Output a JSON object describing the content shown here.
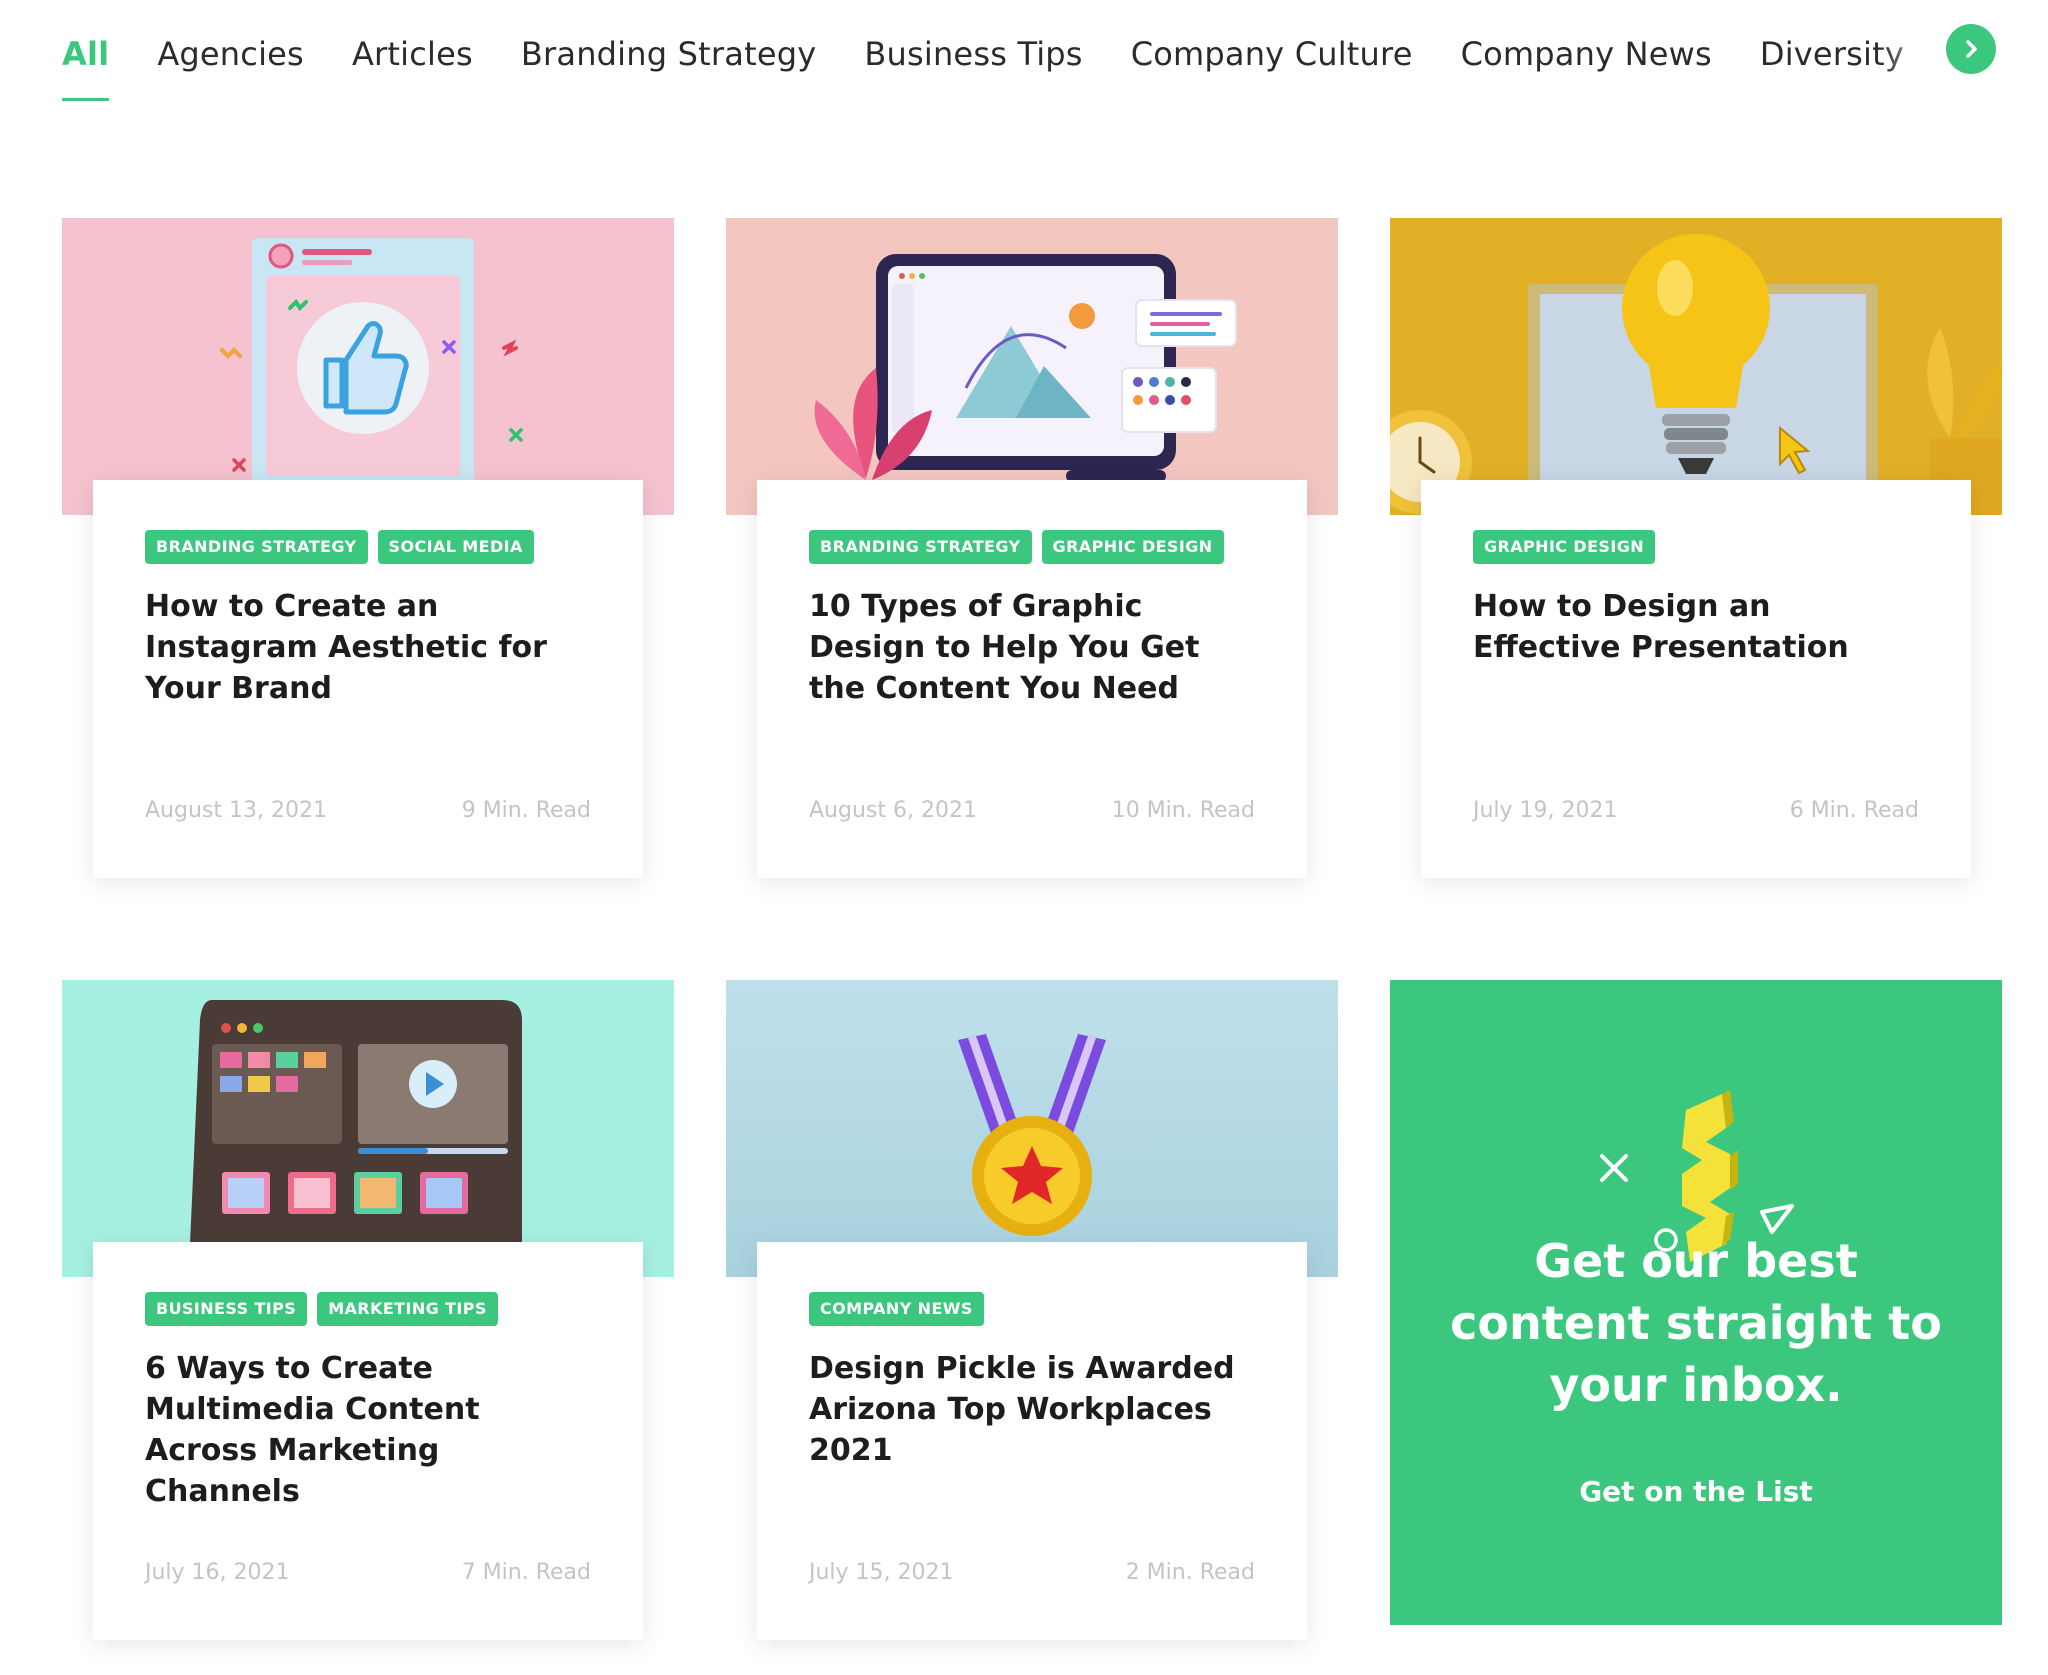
{
  "tabs": {
    "items": [
      "All",
      "Agencies",
      "Articles",
      "Branding Strategy",
      "Business Tips",
      "Company Culture",
      "Company News",
      "Diversity"
    ]
  },
  "colors": {
    "accent": "#3cc77f",
    "meta": "#c4c4c4",
    "title": "#1d1d1d"
  },
  "posts": [
    {
      "tags": [
        "Branding Strategy",
        "Social Media"
      ],
      "title": "How to Create an Instagram Aesthetic for Your Brand",
      "date": "August 13, 2021",
      "read_time": "9 Min. Read",
      "image": "thumbs-up-social-post-illustration"
    },
    {
      "tags": [
        "Branding Strategy",
        "Graphic Design"
      ],
      "title": "10 Types of Graphic Design to Help You Get the Content You Need",
      "date": "August 6, 2021",
      "read_time": "10 Min. Read",
      "image": "design-app-window-illustration"
    },
    {
      "tags": [
        "Graphic Design"
      ],
      "title": "How to Design an Effective Presentation",
      "date": "July 19, 2021",
      "read_time": "6 Min. Read",
      "image": "lightbulb-presentation-illustration"
    },
    {
      "tags": [
        "Business Tips",
        "Marketing Tips"
      ],
      "title": "6 Ways to Create Multimedia Content Across Marketing Channels",
      "date": "July 16, 2021",
      "read_time": "7 Min. Read",
      "image": "media-tablet-illustration"
    },
    {
      "tags": [
        "Company News"
      ],
      "title": "Design Pickle is Awarded Arizona Top Workplaces 2021",
      "date": "July 15, 2021",
      "read_time": "2 Min. Read",
      "image": "award-medal-illustration"
    }
  ],
  "newsletter": {
    "headline": "Get our best content straight to your inbox.",
    "cta": "Get on the List"
  }
}
